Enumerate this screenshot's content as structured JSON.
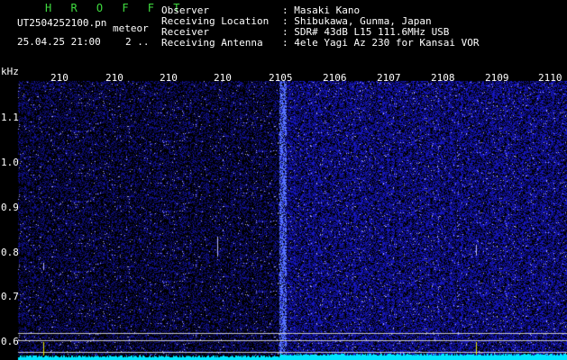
{
  "header": {
    "program": "H R O F F T",
    "filename": "UT2504252100.pn",
    "meteor_label": "meteor",
    "datetime": "25.04.25 21:00",
    "count": "2 .."
  },
  "info": {
    "labels": [
      "Observer",
      "Receiving Location",
      "Receiver",
      "Receiving Antenna"
    ],
    "values": [
      ": Masaki Kano",
      ": Shibukawa, Gunma, Japan",
      ": SDR# 43dB L15 111.6MHz USB",
      ": 4ele Yagi Az 230 for Kansai VOR"
    ]
  },
  "axes": {
    "y_unit": "kHz",
    "y_ticks": [
      "1.1",
      "1.0",
      "0.9",
      "0.8",
      "0.7",
      "0.6"
    ],
    "x_ticks": [
      "210",
      "210",
      "210",
      "210",
      "2105",
      "2106",
      "2107",
      "2108",
      "2109",
      "2110"
    ]
  },
  "colors": {
    "background": "#000000",
    "noise": "#1a1aa0",
    "noise_bright": "#3a3aff",
    "meter": "#00e5ff",
    "header_green": "#3fdc3f"
  }
}
